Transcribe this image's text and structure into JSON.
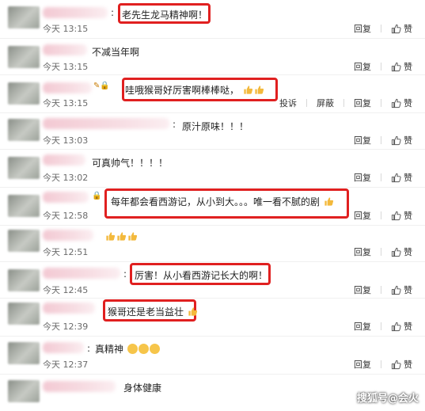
{
  "comments": [
    {
      "text": "老先生龙马精神啊！",
      "time": "今天 13:15",
      "actions": [
        "回复",
        "赞"
      ]
    },
    {
      "text": "不减当年啊",
      "time": "今天 13:15",
      "actions": [
        "回复",
        "赞"
      ]
    },
    {
      "text": "哇哦猴哥好厉害啊棒棒哒，",
      "time": "今天 13:15",
      "actions": [
        "投诉",
        "屏蔽",
        "回复",
        "赞"
      ]
    },
    {
      "text": "原汁原味！！！",
      "time": "今天 13:03",
      "actions": [
        "回复",
        "赞"
      ]
    },
    {
      "text": "可真帅气！！！！",
      "time": "今天 13:02",
      "actions": [
        "回复",
        "赞"
      ]
    },
    {
      "text": "每年都会看西游记，从小到大。。。唯一看不腻的剧",
      "time": "今天 12:58",
      "actions": [
        "回复",
        "赞"
      ]
    },
    {
      "text": "",
      "time": "今天 12:51",
      "actions": [
        "回复",
        "赞"
      ]
    },
    {
      "text": "厉害！从小看西游记长大的啊！",
      "time": "今天 12:45",
      "actions": [
        "回复",
        "赞"
      ]
    },
    {
      "text": "猴哥还是老当益壮",
      "time": "今天 12:39",
      "actions": [
        "回复",
        "赞"
      ]
    },
    {
      "text": "真精神",
      "time": "今天 12:37",
      "actions": [
        "回复",
        "赞"
      ]
    },
    {
      "text": "身体健康",
      "time": "",
      "actions": []
    }
  ],
  "watermark": "搜狐号@会火",
  "colors": {
    "highlight": "#e02020",
    "emoji": "#f6c54a"
  }
}
